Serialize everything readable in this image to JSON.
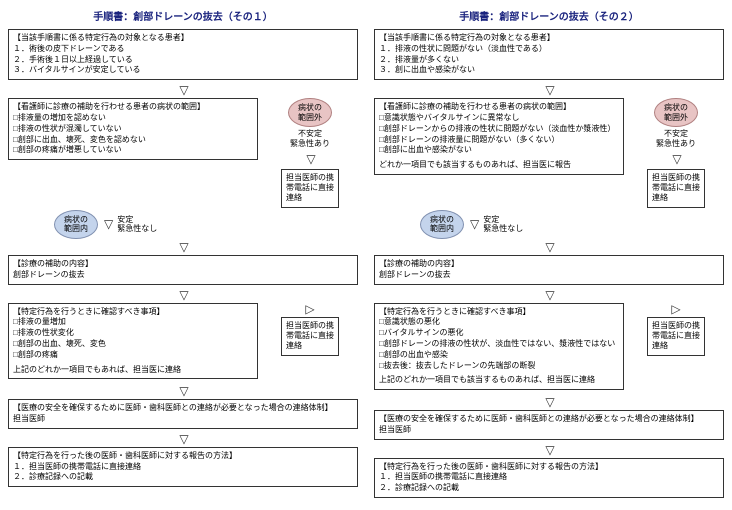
{
  "left": {
    "title": "手順書：創部ドレーンの抜去（その１）",
    "box1": {
      "hd": "【当該手順書に係る特定行為の対象となる患者】",
      "l1": "１．術後の皮下ドレーンである",
      "l2": "２．手術後１日以上経過している",
      "l3": "３．バイタルサインが安定している"
    },
    "box2": {
      "hd": "【看護師に診療の補助を行わせる患者の病状の範囲】",
      "l1": "□排液量の増加を認めない",
      "l2": "□排液の性状が混濁していない",
      "l3": "□創部に出血、壊死、変色を認めない",
      "l4": "□創部の疼痛が増悪していない"
    },
    "oval_out": "病状の\n範囲外",
    "unstable": "不安定\n緊急性あり",
    "oval_in": "病状の\n範囲内",
    "stable": "安定\n緊急性なし",
    "contact": "担当医師の携\n帯電話に直接\n連絡",
    "box3": {
      "hd": "【診療の補助の内容】",
      "l1": "創部ドレーンの抜去"
    },
    "box4": {
      "hd": "【特定行為を行うときに確認すべき事項】",
      "l1": "□排液の量増加",
      "l2": "□排液の性状変化",
      "l3": "□創部の出血、壊死、変色",
      "l4": "□創部の疼痛",
      "l5": "上記のどれか一項目でもあれば、担当医に連絡"
    },
    "contact2": "担当医師の携\n帯電話に直接\n連絡",
    "box5": {
      "hd": "【医療の安全を確保するために医師・歯科医師との連絡が必要となった場合の連絡体制】",
      "l1": "担当医師"
    },
    "box6": {
      "hd": "【特定行為を行った後の医師・歯科医師に対する報告の方法】",
      "l1": "１．担当医師の携帯電話に直接連絡",
      "l2": "２．診療記録への記載"
    }
  },
  "right": {
    "title": "手順書：創部ドレーンの抜去（その２）",
    "box1": {
      "hd": "【当該手順書に係る特定行為の対象となる患者】",
      "l1": "１．排液の性状に問題がない（淡血性である）",
      "l2": "２．排液量が多くない",
      "l3": "３．創に出血や感染がない"
    },
    "box2": {
      "hd": "【看護師に診療の補助を行わせる患者の病状の範囲】",
      "l1": "□意識状態やバイタルサインに異常なし",
      "l2": "□創部ドレーンからの排液の性状に問題がない（淡血性か漿液性）",
      "l3": "□創部ドレーンの排液量に問題がない（多くない）",
      "l4": "□創部に出血や感染がない",
      "l5": "どれか一項目でも該当するものあれば、担当医に報告"
    },
    "oval_out": "病状の\n範囲外",
    "unstable": "不安定\n緊急性あり",
    "oval_in": "病状の\n範囲内",
    "stable": "安定\n緊急性なし",
    "contact": "担当医師の携\n帯電話に直接\n連絡",
    "box3": {
      "hd": "【診療の補助の内容】",
      "l1": "創部ドレーンの抜去"
    },
    "box4": {
      "hd": "【特定行為を行うときに確認すべき事項】",
      "l1": "□意識状態の悪化",
      "l2": "□バイタルサインの悪化",
      "l3": "□創部ドレーンの排液の性状が、淡血性ではない、漿液性ではない",
      "l4": "□創部の出血や感染",
      "l5": "□抜去後：抜去したドレーンの先端部の断裂",
      "l6": "上記のどれか一項目でも該当するものあれば、担当医に連絡"
    },
    "contact2": "担当医師の携\n帯電話に直接\n連絡",
    "box5": {
      "hd": "【医療の安全を確保するために医師・歯科医師との連絡が必要となった場合の連絡体制】",
      "l1": "担当医師"
    },
    "box6": {
      "hd": "【特定行為を行った後の医師・歯科医師に対する報告の方法】",
      "l1": "１．担当医師の携帯電話に直接連絡",
      "l2": "２．診療記録への記載"
    }
  }
}
